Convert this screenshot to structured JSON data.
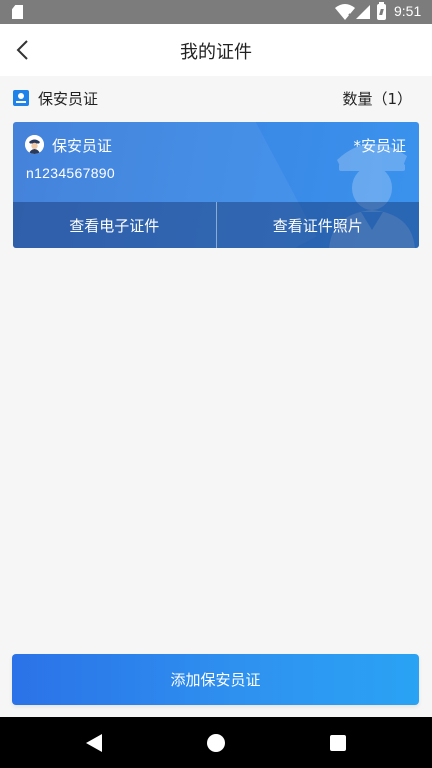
{
  "status_bar": {
    "time": "9:51"
  },
  "header": {
    "title": "我的证件"
  },
  "section": {
    "title": "保安员证",
    "count": "数量（1）"
  },
  "card": {
    "title": "保安员证",
    "tag": "*安员证",
    "number": "n1234567890",
    "actions": {
      "view_electronic": "查看电子证件",
      "view_photo": "查看证件照片"
    }
  },
  "add_button": {
    "label": "添加保安员证"
  },
  "colors": {
    "accent": "#2b7de9",
    "status_bar": "#7c7c7c",
    "background": "#f6f6f7"
  },
  "icons": {
    "status": [
      "sd-card-icon",
      "wifi-icon",
      "signal-icon",
      "battery-icon"
    ],
    "header": "back-arrow-icon",
    "section": "id-badge-icon",
    "card": [
      "guard-avatar-icon",
      "guard-illustration"
    ],
    "nav": [
      "nav-back-icon",
      "nav-home-icon",
      "nav-recent-icon"
    ]
  }
}
